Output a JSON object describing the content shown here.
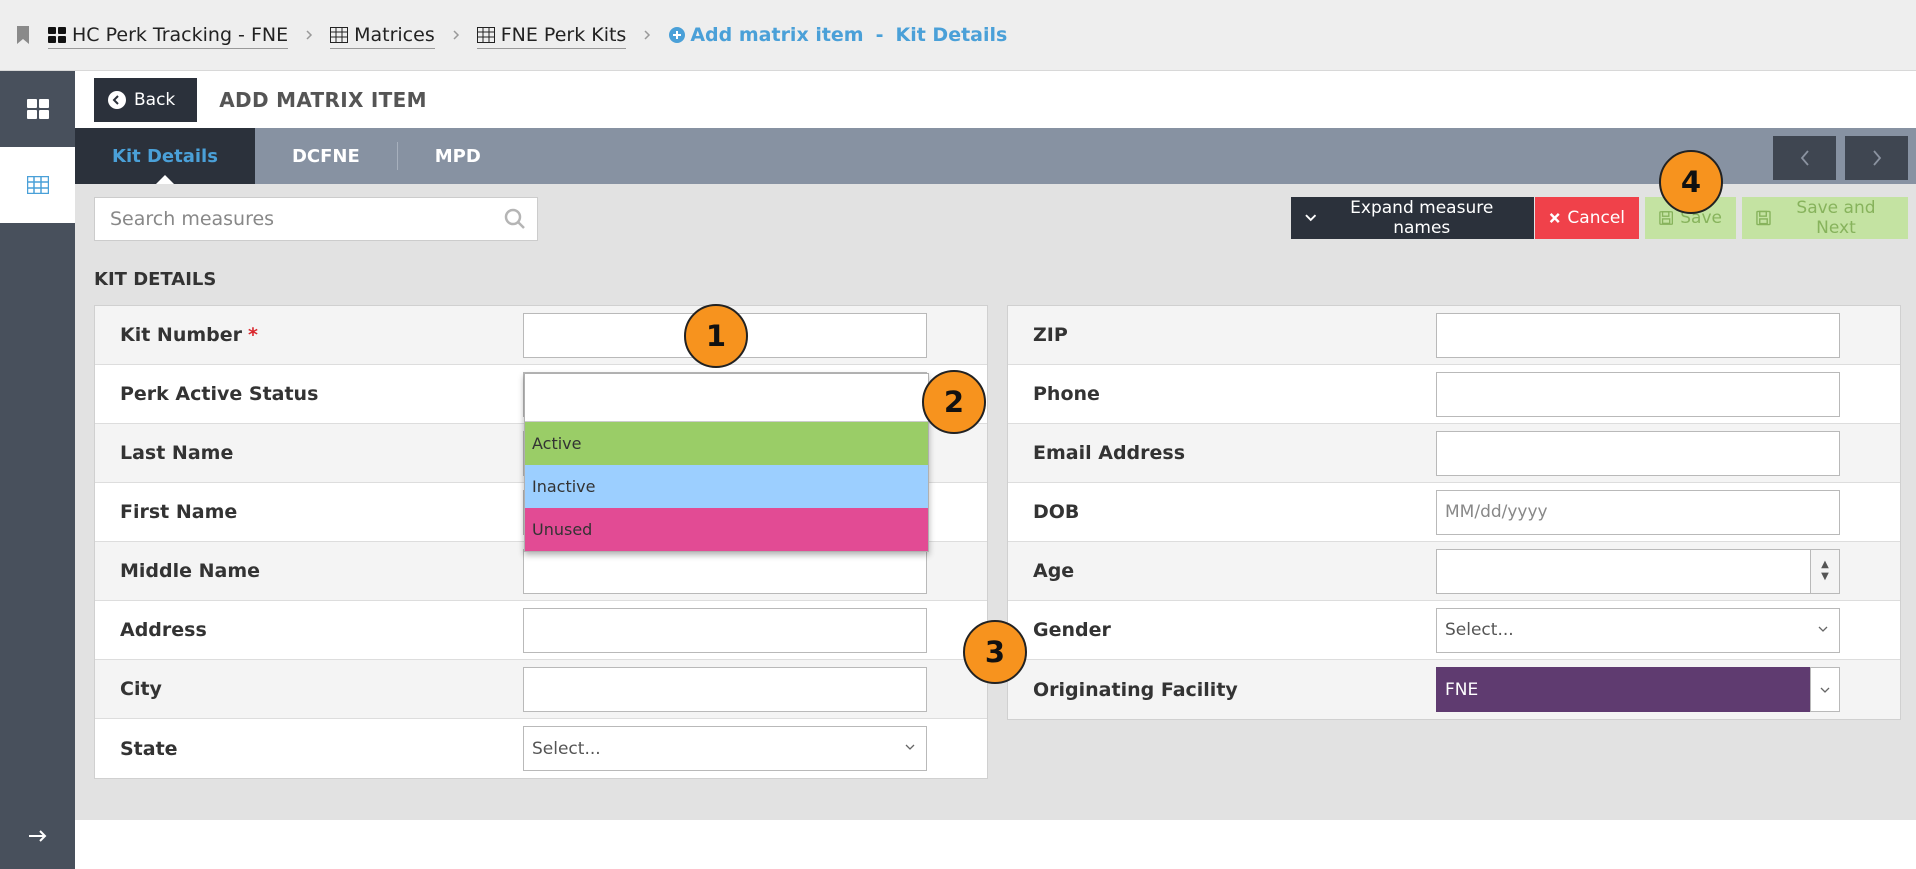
{
  "breadcrumb": {
    "items": [
      {
        "label": "HC Perk Tracking - FNE",
        "icon": "dashboard-icon"
      },
      {
        "label": "Matrices",
        "icon": "table-icon"
      },
      {
        "label": "FNE Perk Kits",
        "icon": "table-icon"
      }
    ],
    "action_label": "Add matrix item",
    "dash": "-",
    "current_label": "Kit Details"
  },
  "header": {
    "back_label": "Back",
    "title": "ADD MATRIX ITEM"
  },
  "tabs": [
    {
      "label": "Kit Details",
      "active": true
    },
    {
      "label": "DCFNE",
      "active": false
    },
    {
      "label": "MPD",
      "active": false
    }
  ],
  "toolbar": {
    "search_placeholder": "Search measures",
    "expand_label": "Expand measure names",
    "cancel_label": "Cancel",
    "save_label": "Save",
    "save_next_label": "Save and Next"
  },
  "section_title": "KIT DETAILS",
  "left_fields": [
    {
      "label": "Kit Number",
      "required": "*",
      "value": ""
    },
    {
      "label": "Perk Active Status",
      "value": ""
    },
    {
      "label": "Last Name",
      "value": ""
    },
    {
      "label": "First Name",
      "value": ""
    },
    {
      "label": "Middle Name",
      "value": ""
    },
    {
      "label": "Address",
      "value": ""
    },
    {
      "label": "City",
      "value": ""
    },
    {
      "label": "State",
      "value": "Select..."
    }
  ],
  "right_fields": [
    {
      "label": "ZIP",
      "value": ""
    },
    {
      "label": "Phone",
      "value": ""
    },
    {
      "label": "Email Address",
      "value": ""
    },
    {
      "label": "DOB",
      "placeholder": "MM/dd/yyyy"
    },
    {
      "label": "Age",
      "value": ""
    },
    {
      "label": "Gender",
      "value": "Select..."
    },
    {
      "label": "Originating Facility",
      "value": "FNE"
    }
  ],
  "dropdown_options": [
    {
      "label": "Active",
      "color": "#9acd67"
    },
    {
      "label": "Inactive",
      "color": "#9ccfff"
    },
    {
      "label": "Unused",
      "color": "#e24b94"
    }
  ],
  "callouts": [
    "1",
    "2",
    "3",
    "4"
  ],
  "colors": {
    "accent": "#4aa0d8",
    "cancel": "#f0414a",
    "save": "#c4e3a2",
    "facility": "#5f3b70"
  }
}
